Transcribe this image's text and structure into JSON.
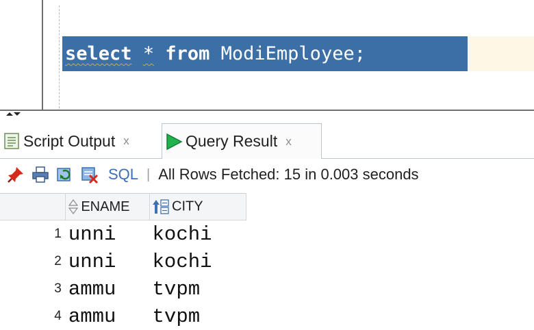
{
  "editor": {
    "keyword_select": "select",
    "star": "*",
    "keyword_from": "from",
    "table_name": "ModiEmployee;"
  },
  "tabs": [
    {
      "label": "Script Output",
      "close": "x",
      "icon": "script-output-icon"
    },
    {
      "label": "Query Result",
      "close": "x",
      "icon": "run-icon"
    }
  ],
  "toolbar": {
    "icons": [
      "pin-icon",
      "print-icon",
      "refresh-icon",
      "clear-icon"
    ],
    "sql_label": "SQL",
    "separator": "|",
    "status": "All Rows Fetched: 15 in 0.003 seconds"
  },
  "grid": {
    "columns": [
      {
        "label": "ENAME",
        "icon": "sort-updown-icon"
      },
      {
        "label": "CITY",
        "icon": "sort-az-icon"
      }
    ],
    "rows": [
      {
        "num": "1",
        "ename": "unni",
        "city": "kochi"
      },
      {
        "num": "2",
        "ename": "unni",
        "city": "kochi"
      },
      {
        "num": "3",
        "ename": "ammu",
        "city": "tvpm"
      },
      {
        "num": "4",
        "ename": "ammu",
        "city": "tvpm"
      }
    ]
  },
  "colors": {
    "selection": "#3b6fa6",
    "sql_link": "#3d6fb5",
    "run_arrow": "#22b14c"
  }
}
